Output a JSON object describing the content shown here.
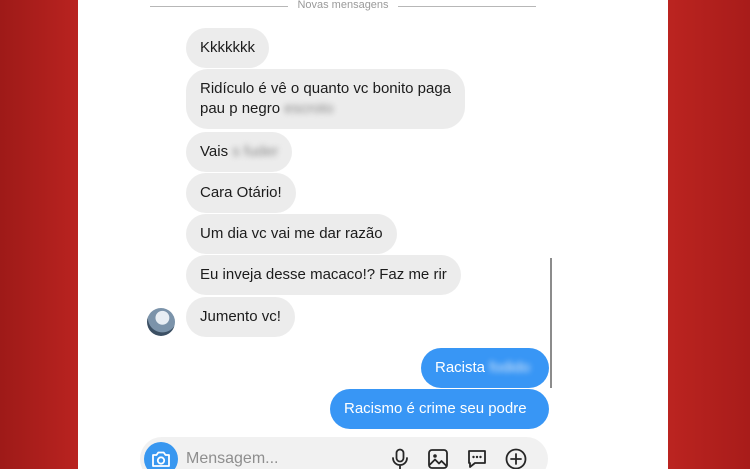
{
  "header": {
    "new_messages": "Novas mensagens"
  },
  "messages": [
    {
      "dir": "in",
      "text": "Kkkkkkk"
    },
    {
      "dir": "in",
      "line1": "Ridículo é vê o quanto vc bonito paga",
      "line2": "pau p negro",
      "blurred": "escroto"
    },
    {
      "dir": "in",
      "text": "Vais",
      "blurred": "s fuder"
    },
    {
      "dir": "in",
      "text": "Cara Otário!"
    },
    {
      "dir": "in",
      "text": "Um dia vc vai me dar razão"
    },
    {
      "dir": "in",
      "text": "Eu inveja desse macaco!? Faz me rir"
    },
    {
      "dir": "in",
      "text": "Jumento vc!"
    },
    {
      "dir": "out",
      "text": "Racista",
      "blurred": "fodido"
    },
    {
      "dir": "out",
      "text": "Racismo é crime seu podre"
    }
  ],
  "composer": {
    "placeholder": "Mensagem..."
  },
  "colors": {
    "sent_bubble": "#3896f5",
    "received_bubble": "#ececec",
    "frame": "#b3201d"
  }
}
